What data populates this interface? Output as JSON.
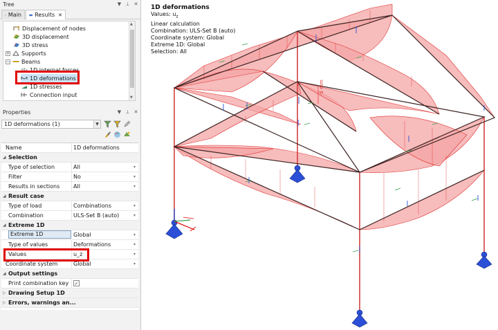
{
  "tree_panel": {
    "title": "Tree",
    "tabs": [
      {
        "label": "Main",
        "icon": "main-tab-icon"
      },
      {
        "label": "Results",
        "icon": "results-tab-icon"
      }
    ],
    "items": [
      {
        "label": "Displacement of nodes",
        "icon": "displacement-nodes-icon"
      },
      {
        "label": "3D displacement",
        "icon": "3d-displacement-icon"
      },
      {
        "label": "3D stress",
        "icon": "3d-stress-icon"
      },
      {
        "label": "Supports",
        "icon": "supports-icon"
      },
      {
        "label": "Beams",
        "icon": "beams-icon"
      },
      {
        "label": "1D internal forces",
        "icon": "internal-forces-icon"
      },
      {
        "label": "1D deformations",
        "icon": "deformations-icon"
      },
      {
        "label": "1D stresses",
        "icon": "stresses-icon"
      },
      {
        "label": "Connection input",
        "icon": "connection-input-icon"
      }
    ]
  },
  "properties_panel": {
    "title": "Properties",
    "selector_value": "1D deformations (1)",
    "name_label": "Name",
    "name_value": "1D deformations",
    "sections": {
      "selection": "Selection",
      "result_case": "Result case",
      "extreme_1d": "Extreme 1D",
      "output_settings": "Output settings",
      "drawing_setup": "Drawing Setup 1D",
      "errors": "Errors, warnings an..."
    },
    "rows": {
      "type_of_selection": {
        "label": "Type of selection",
        "value": "All"
      },
      "filter": {
        "label": "Filter",
        "value": "No"
      },
      "results_in_sections": {
        "label": "Results in sections",
        "value": "All"
      },
      "type_of_load": {
        "label": "Type of load",
        "value": "Combinations"
      },
      "combination": {
        "label": "Combination",
        "value": "ULS-Set B (auto)"
      },
      "extreme_1d": {
        "label": "Extreme 1D",
        "value": "Global"
      },
      "type_of_values": {
        "label": "Type of values",
        "value": "Deformations"
      },
      "values": {
        "label": "Values",
        "value": "u_z"
      },
      "coordinate_system": {
        "label": "Coordinate system",
        "value": "Global"
      },
      "print_combination_key": {
        "label": "Print combination key",
        "checked": true
      }
    }
  },
  "viewport": {
    "info": {
      "title": "1D deformations",
      "values": "Values: u",
      "values_sub": "z",
      "calc": "Linear calculation",
      "combination": "Combination: ULS-Set B (auto)",
      "coord": "Coordinate system: Global",
      "extreme": "Extreme 1D: Global",
      "selection": "Selection: All"
    },
    "axis_label": "-5 mm",
    "colors": {
      "diagram_fill": "#f4a6a6",
      "diagram_stroke": "#e03030",
      "frame": "#5a2e2e",
      "support": "#2b4fd6",
      "highlight": "#e00000"
    }
  }
}
